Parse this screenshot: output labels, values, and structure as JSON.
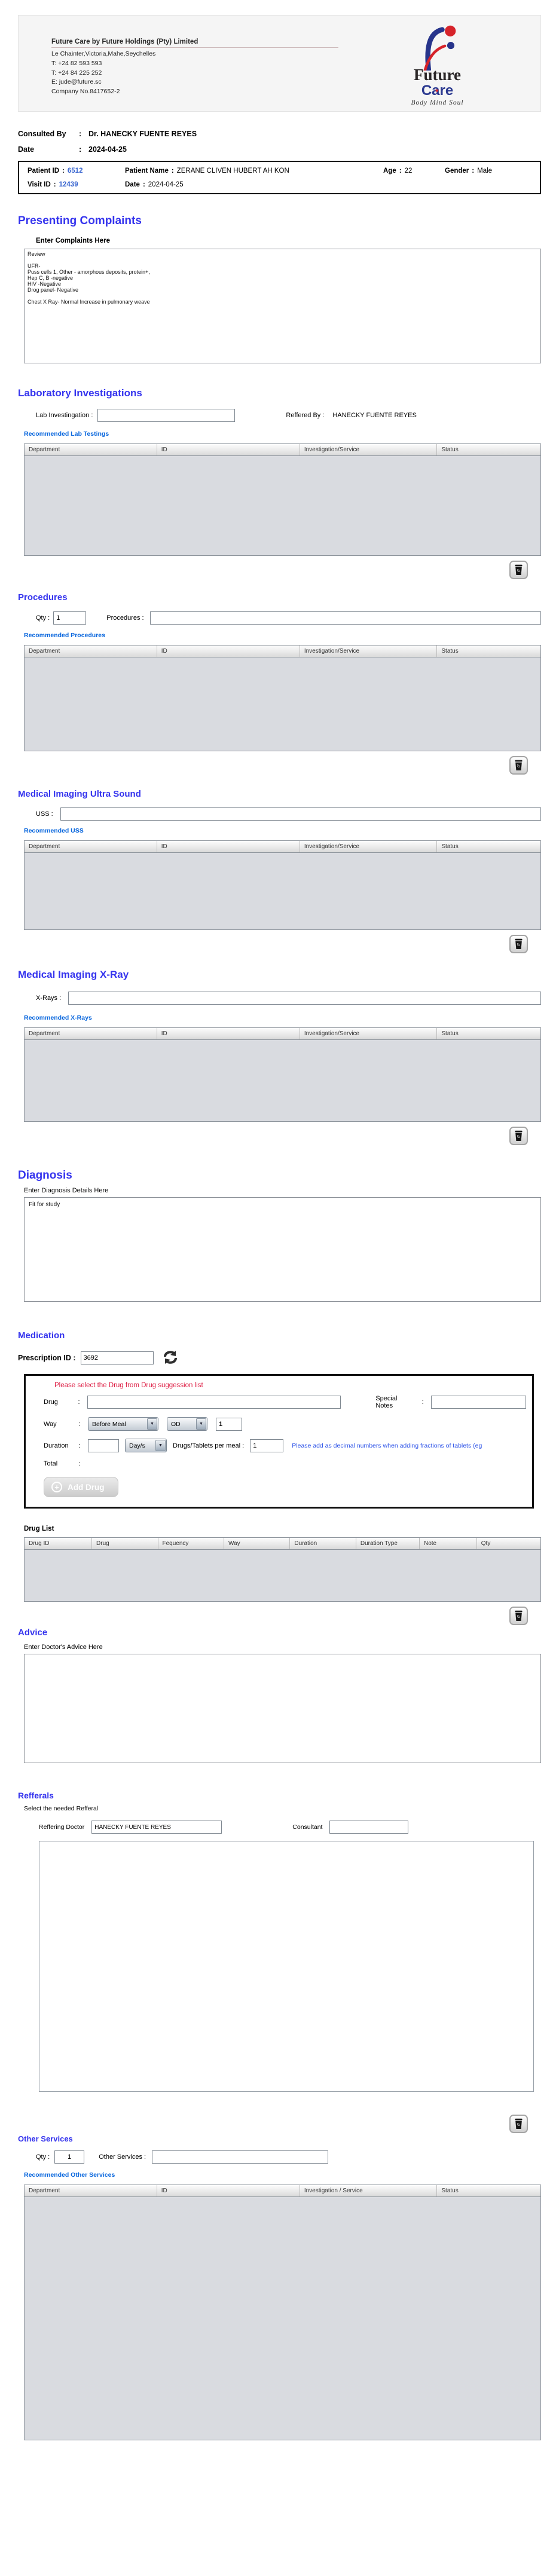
{
  "ui": {
    "colon": ":",
    "dropdown_arrow": "▼"
  },
  "header": {
    "company_name": "Future Care by Future Holdings (Pty) Limited",
    "address_lines": [
      "Le Chainter,Victoria,Mahe,Seychelles",
      "T: +24  82 593 593",
      "T: +24  84 225 252",
      "E: jude@future.sc",
      "Company No.8417652-2"
    ],
    "logo": {
      "word1": "Future",
      "word2": "Care",
      "tagline": "Body Mind Soul"
    }
  },
  "consultation": {
    "consulted_by_label": "Consulted By",
    "consulted_by_value": "Dr.  HANECKY FUENTE REYES",
    "date_label": "Date",
    "date_value": "2024-04-25"
  },
  "patient": {
    "patient_id_label": "Patient ID",
    "patient_id": "6512",
    "patient_name_label": "Patient Name",
    "patient_name": "ZERANE CLIVEN HUBERT AH KON",
    "age_label": "Age",
    "age": "22",
    "gender_label": "Gender",
    "gender": "Male",
    "visit_id_label": "Visit ID",
    "visit_id": "12439",
    "date_label": "Date",
    "date": "2024-04-25"
  },
  "presenting_complaints": {
    "title": "Presenting Complaints",
    "label": "Enter Complaints Here",
    "text": "Review\n\nUFR-\nPuss cells 1, Other - amorphous deposits, protein+,\nHep C, B -negative\nHIV -Negative\nDrog panel- Negative\n\nChest X Ray- Normal Increase in pulmonary weave"
  },
  "laboratory": {
    "title": "Laboratory  Investigations",
    "input_label": "Lab Investingation :",
    "input_value": "",
    "referred_by_label": "Reffered By :",
    "referred_by_value": "HANECKY FUENTE REYES",
    "recommended_link": "Recommended Lab Testings",
    "table_headers": [
      "Department",
      "ID",
      "Investigation/Service",
      "Status"
    ]
  },
  "procedures": {
    "title": "Procedures",
    "qty_label": "Qty :",
    "qty_value": "1",
    "input_label": "Procedures :",
    "input_value": "",
    "recommended_link": "Recommended Procedures",
    "table_headers": [
      "Department",
      "ID",
      "Investigation/Service",
      "Status"
    ]
  },
  "ultrasound": {
    "title": "Medical Imaging Ultra Sound",
    "input_label": "USS :",
    "input_value": "",
    "recommended_link": "Recommended USS",
    "table_headers": [
      "Department",
      "ID",
      "Investigation/Service",
      "Status"
    ]
  },
  "xray": {
    "title": "Medical Imaging X-Ray",
    "input_label": "X-Rays :",
    "input_value": "",
    "recommended_link": "Recommended X-Rays",
    "table_headers": [
      "Department",
      "ID",
      "Investigation/Service",
      "Status"
    ]
  },
  "diagnosis": {
    "title": "Diagnosis",
    "label": "Enter Diagnosis Details Here",
    "text": "Fit for study"
  },
  "medication": {
    "title": "Medication",
    "prescription_id_label": "Prescription ID :",
    "prescription_id_value": "3692",
    "panel_warning": "Please select the Drug from Drug suggession list",
    "drug_label": "Drug",
    "drug_value": "",
    "special_notes_label": "Special Notes",
    "special_notes_value": "",
    "way_label": "Way",
    "way_value": "Before Meal",
    "frequency_value": "OD",
    "way_qty_value": "1",
    "duration_label": "Duration",
    "duration_value": "",
    "duration_unit_value": "Day/s",
    "per_meal_label": "Drugs/Tablets per meal :",
    "per_meal_value": "1",
    "fraction_note": "Please add as decimal numbers when adding fractions of tablets (eg",
    "total_label": "Total",
    "add_drug_button": "Add Drug",
    "drug_list_label": "Drug List",
    "drug_table_headers": [
      "Drug ID",
      "Drug",
      "Fequency",
      "Way",
      "Duration",
      "Duration Type",
      "Note",
      "Qty"
    ]
  },
  "advice": {
    "title": "Advice",
    "label": "Enter Doctor's Advice Here",
    "text": ""
  },
  "referrals": {
    "title": "Refferals",
    "subtitle": "Select the needed Refferal",
    "referring_doctor_label": "Reffering Doctor",
    "referring_doctor_value": "HANECKY FUENTE REYES",
    "consultant_label": "Consultant",
    "consultant_value": ""
  },
  "other_services": {
    "title": "Other Services",
    "qty_label": "Qty :",
    "qty_value": "1",
    "input_label": "Other Services :",
    "input_value": "",
    "recommended_link": "Recommended Other Services",
    "table_headers": [
      "Department",
      "ID",
      "Investigation / Service",
      "Status"
    ]
  }
}
